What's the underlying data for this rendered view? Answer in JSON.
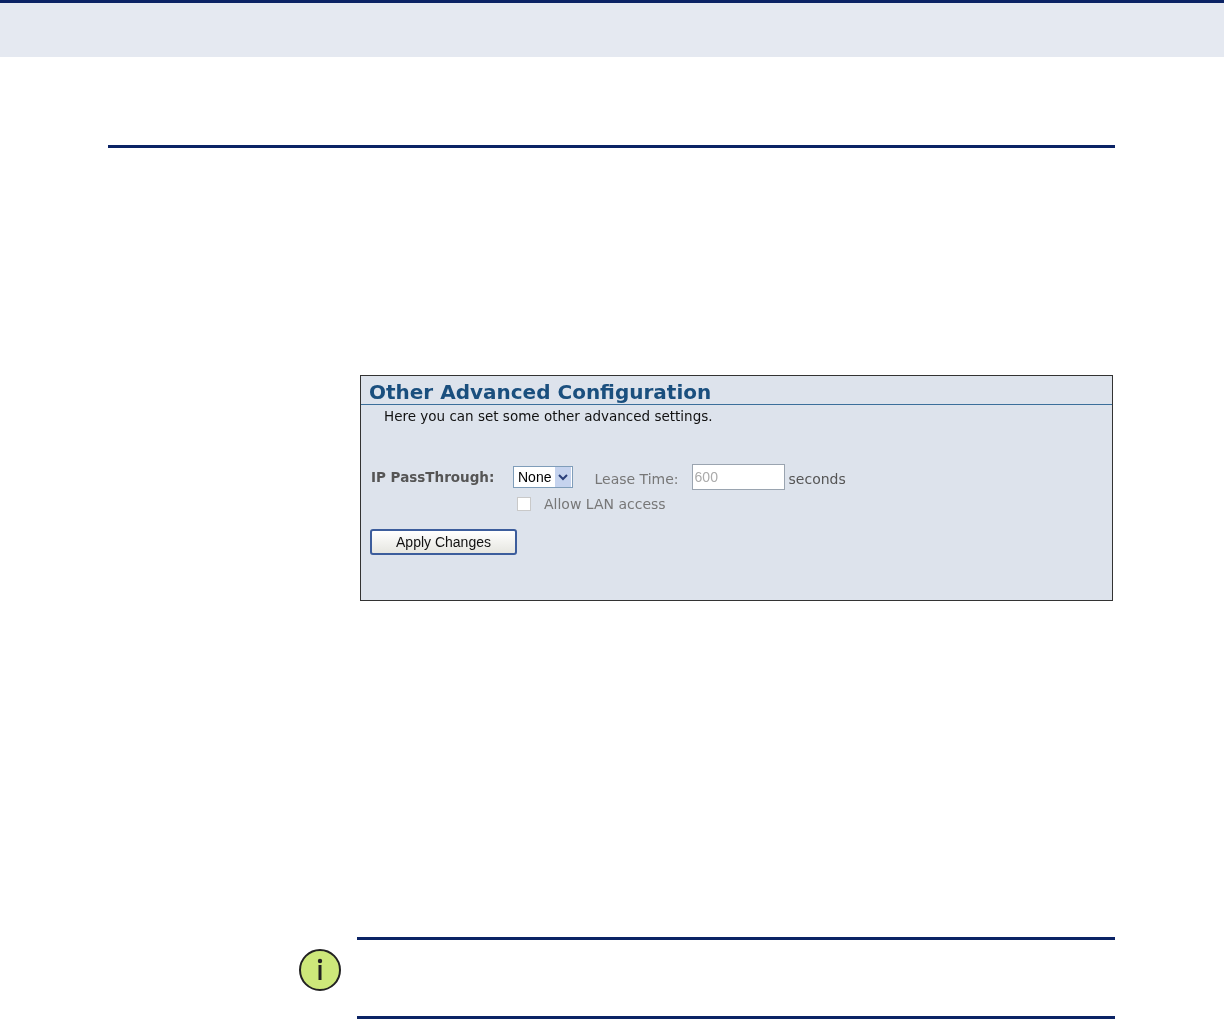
{
  "panel": {
    "title": "Other Advanced Configuration",
    "description": "Here you can set some other advanced settings.",
    "ip_passthrough": {
      "label": "IP PassThrough:",
      "value": "None"
    },
    "lease_time": {
      "label": "Lease Time:",
      "value": "600",
      "unit": "seconds",
      "disabled": true
    },
    "allow_lan": {
      "label": "Allow LAN access",
      "checked": false,
      "disabled": true
    },
    "apply_button": "Apply Changes"
  }
}
